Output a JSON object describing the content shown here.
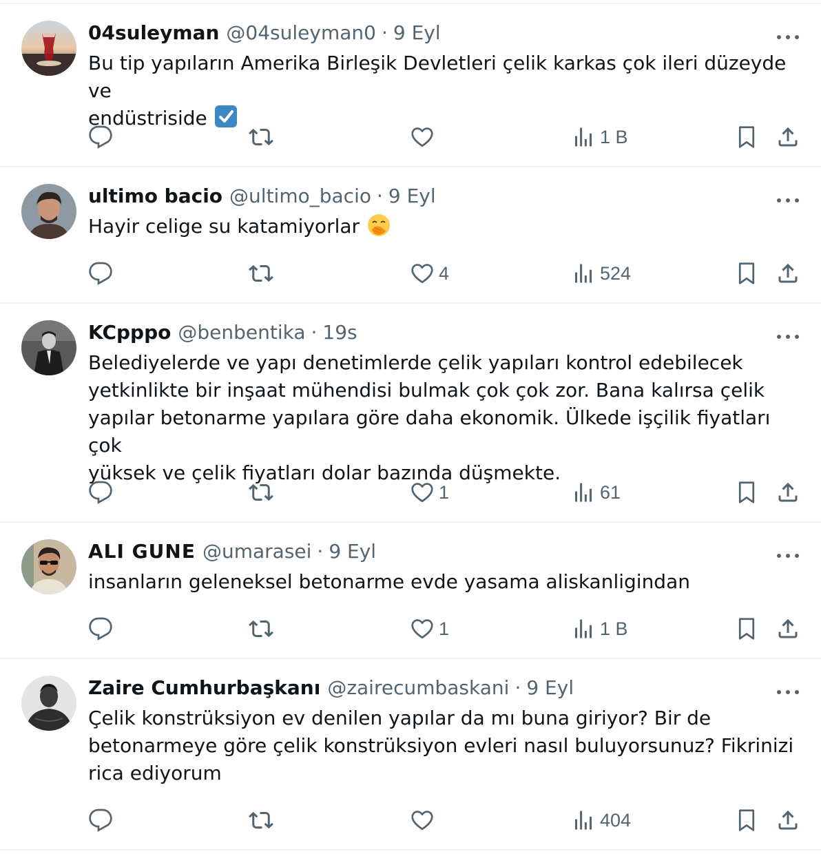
{
  "tweets": [
    {
      "display_name": "04suleyman",
      "handle": "@04suleyman0",
      "separator": "·",
      "time": "9 Eyl",
      "lines": [
        "Bu tip yapıların Amerika Birleşik Devletleri çelik karkas çok ileri düzeyde ve",
        "endüstriside"
      ],
      "emoji": "check-mark-button-emoji",
      "reply_count": "",
      "retweet_count": "",
      "like_count": "",
      "view_count": "1 B",
      "avatar": "tea-glass-avatar"
    },
    {
      "display_name": "ultimo bacio",
      "handle": "@ultimo_bacio",
      "separator": "·",
      "time": "9 Eyl",
      "lines": [
        "Hayir celige su katamiyorlar"
      ],
      "emoji": "face-with-hand-over-mouth-emoji",
      "reply_count": "",
      "retweet_count": "",
      "like_count": "4",
      "view_count": "524",
      "avatar": "man-portrait-avatar"
    },
    {
      "display_name": "KCpppo",
      "handle": "@benbentika",
      "separator": "·",
      "time": "19s",
      "lines": [
        "Belediyelerde ve yapı denetimlerde çelik yapıları kontrol edebilecek",
        "yetkinlikte bir inşaat mühendisi bulmak çok çok zor. Bana kalırsa çelik",
        "yapılar betonarme yapılara göre daha ekonomik. Ülkede işçilik fiyatları çok",
        "yüksek ve çelik fiyatları dolar bazında düşmekte."
      ],
      "reply_count": "",
      "retweet_count": "",
      "like_count": "1",
      "view_count": "61",
      "avatar": "bw-portrait-avatar"
    },
    {
      "display_name": "ALI GUNE",
      "handle": "@umarasei",
      "separator": "·",
      "time": "9 Eyl",
      "lines": [
        "insanların geleneksel betonarme evde yasama aliskanligindan"
      ],
      "reply_count": "",
      "retweet_count": "",
      "like_count": "1",
      "view_count": "1 B",
      "avatar": "sunglasses-man-avatar"
    },
    {
      "display_name": "Zaire Cumhurbaşkanı",
      "handle": "@zairecumbaskani",
      "separator": "·",
      "time": "9 Eyl",
      "lines": [
        "Çelik konstrüksiyon ev denilen yapılar da mı buna giriyor? Bir de",
        "betonarmeye göre çelik konstrüksiyon evleri nasıl buluyorsunuz? Fikrinizi",
        "rica ediyorum"
      ],
      "reply_count": "",
      "retweet_count": "",
      "like_count": "",
      "view_count": "404",
      "avatar": "boxer-portrait-avatar"
    }
  ],
  "colors": {
    "text": "#0f1419",
    "secondary": "#536471",
    "divider": "#eff3f4",
    "check_blue": "#3b88c3"
  }
}
